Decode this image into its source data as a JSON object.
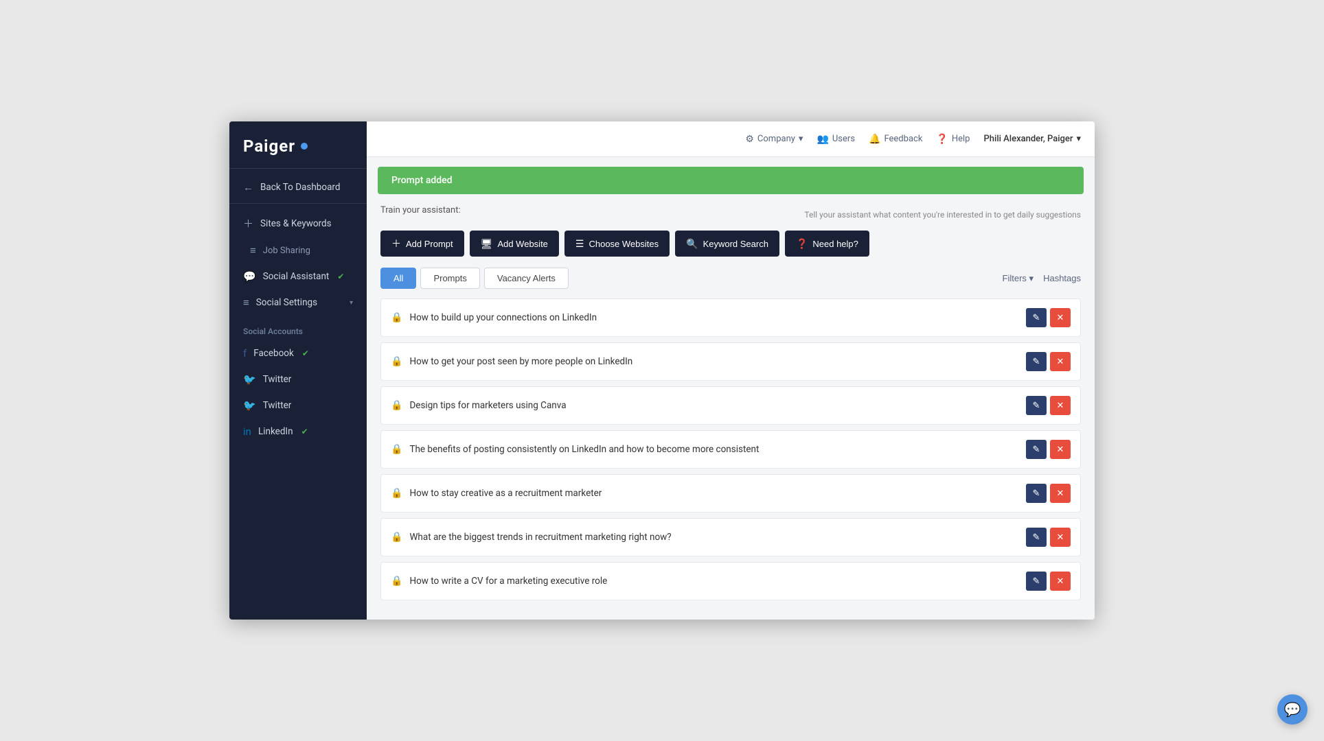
{
  "app": {
    "logo": "Paiger",
    "window_bg": "#e8e8e8"
  },
  "topnav": {
    "company_label": "Company",
    "users_label": "Users",
    "feedback_label": "Feedback",
    "help_label": "Help",
    "user_label": "Phili Alexander, Paiger"
  },
  "sidebar": {
    "back_label": "Back To Dashboard",
    "menu_items": [
      {
        "id": "sites-keywords",
        "label": "Sites & Keywords",
        "icon": "+"
      },
      {
        "id": "job-sharing",
        "label": "Job Sharing",
        "icon": "≡",
        "sub": true
      },
      {
        "id": "social-assistant",
        "label": "Social Assistant",
        "icon": "💬",
        "check": true
      },
      {
        "id": "social-settings",
        "label": "Social Settings",
        "icon": "≡",
        "arrow": true
      }
    ],
    "social_accounts_label": "Social Accounts",
    "accounts": [
      {
        "id": "facebook",
        "label": "Facebook",
        "icon": "facebook",
        "check": true
      },
      {
        "id": "twitter1",
        "label": "Twitter",
        "icon": "twitter"
      },
      {
        "id": "twitter2",
        "label": "Twitter",
        "icon": "twitter"
      },
      {
        "id": "linkedin",
        "label": "LinkedIn",
        "icon": "linkedin",
        "check": true
      }
    ]
  },
  "alert": {
    "message": "Prompt added"
  },
  "train": {
    "label": "Train your assistant:",
    "hint": "Tell your assistant what content you're interested in to get daily suggestions",
    "buttons": [
      {
        "id": "add-prompt",
        "label": "Add Prompt",
        "icon": "＋"
      },
      {
        "id": "add-website",
        "label": "Add Website",
        "icon": "🖥"
      },
      {
        "id": "choose-websites",
        "label": "Choose Websites",
        "icon": "☰"
      },
      {
        "id": "keyword-search",
        "label": "Keyword Search",
        "icon": "🔍"
      },
      {
        "id": "need-help",
        "label": "Need help?",
        "icon": "?"
      }
    ]
  },
  "tabs": [
    {
      "id": "all",
      "label": "All",
      "active": true
    },
    {
      "id": "prompts",
      "label": "Prompts",
      "active": false
    },
    {
      "id": "vacancy-alerts",
      "label": "Vacancy Alerts",
      "active": false
    }
  ],
  "filters": [
    {
      "id": "filters",
      "label": "Filters ▾"
    },
    {
      "id": "hashtags",
      "label": "Hashtags"
    }
  ],
  "prompts": [
    {
      "id": "p1",
      "text": "How to build up your connections on LinkedIn"
    },
    {
      "id": "p2",
      "text": "How to get your post seen by more people on LinkedIn"
    },
    {
      "id": "p3",
      "text": "Design tips for marketers using Canva"
    },
    {
      "id": "p4",
      "text": "The benefits of posting consistently on LinkedIn and how to become more consistent"
    },
    {
      "id": "p5",
      "text": "How to stay creative as a recruitment marketer"
    },
    {
      "id": "p6",
      "text": "What are the biggest trends in recruitment marketing right now?"
    },
    {
      "id": "p7",
      "text": "How to write a CV for a marketing executive role"
    }
  ],
  "actions": {
    "edit_label": "✎",
    "delete_label": "✕"
  }
}
